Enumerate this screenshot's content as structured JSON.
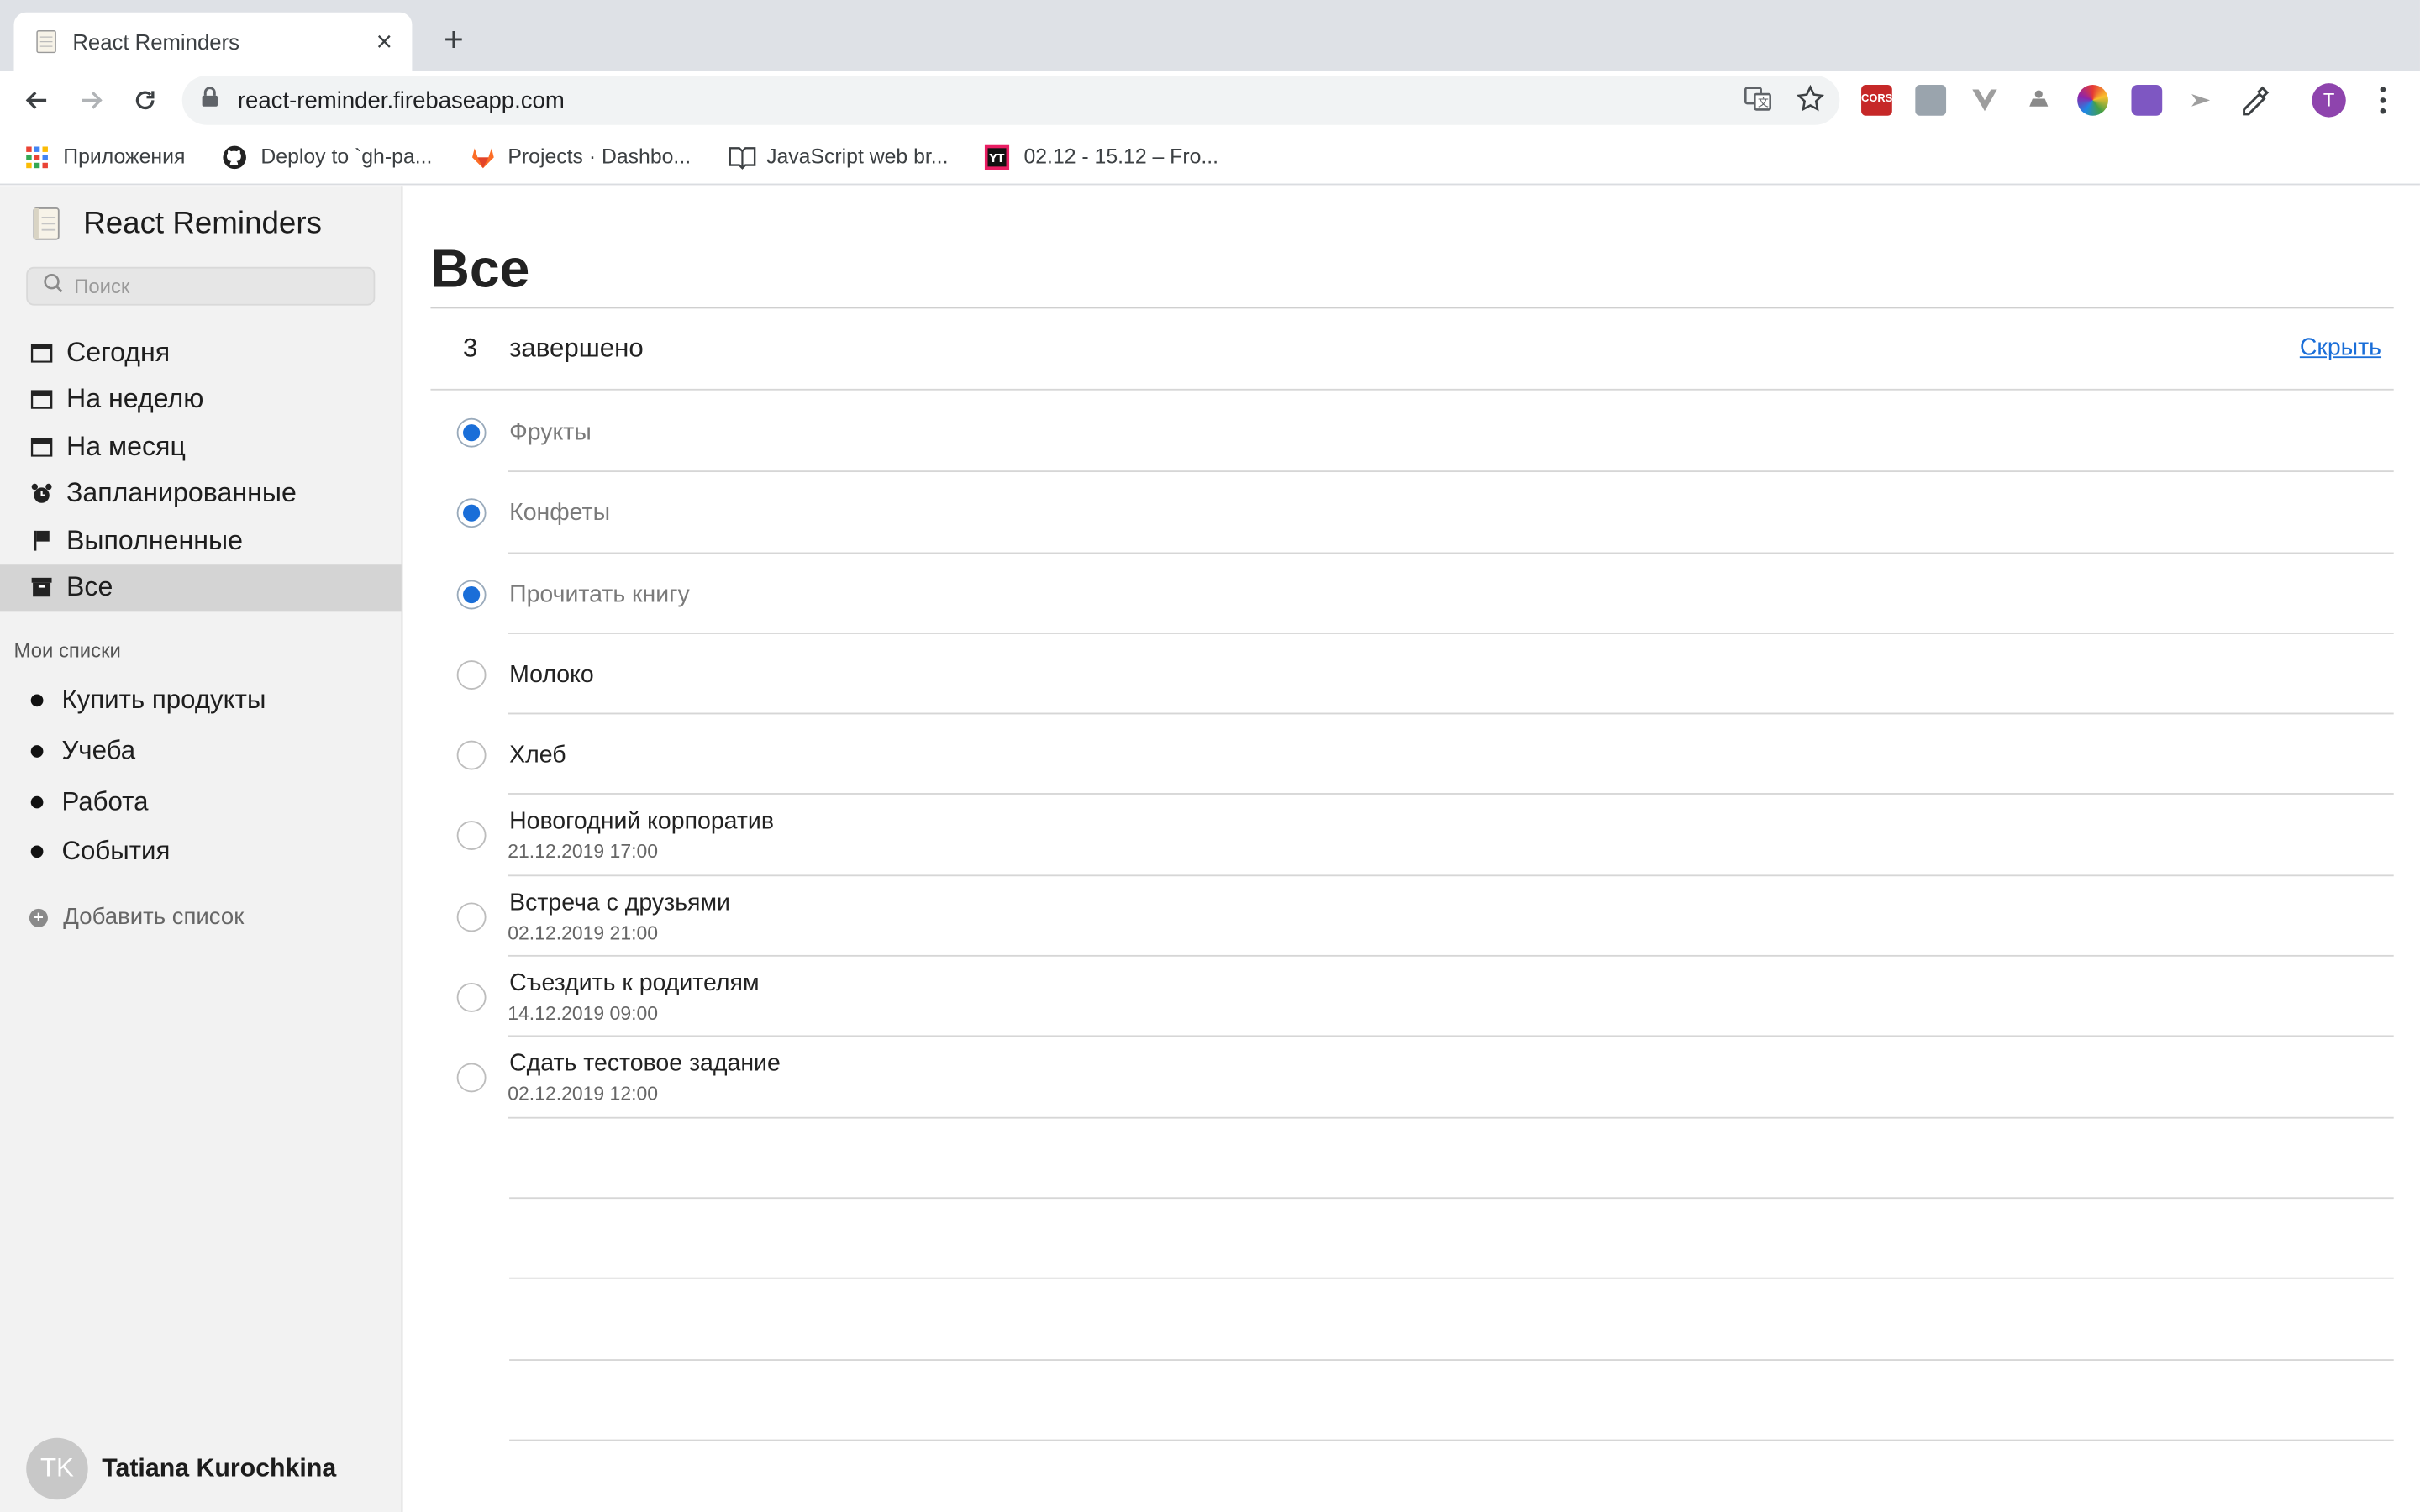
{
  "browser": {
    "tab_title": "React Reminders",
    "url": "react-reminder.firebaseapp.com",
    "bookmarks": [
      {
        "label": "Приложения",
        "icon": "apps-grid-icon"
      },
      {
        "label": "Deploy to `gh-pa...",
        "icon": "github-icon"
      },
      {
        "label": "Projects · Dashbo...",
        "icon": "gitlab-icon"
      },
      {
        "label": "JavaScript web br...",
        "icon": "book-icon"
      },
      {
        "label": "02.12 - 15.12 – Fro...",
        "icon": "youtrack-icon"
      }
    ],
    "profile_initial": "T",
    "extensions": [
      "cors-extension-icon",
      "profile-extension-icon",
      "vue-devtools-icon",
      "extension-icon",
      "color-picker-icon",
      "redux-devtools-icon",
      "extension-icon",
      "paint-extension-icon"
    ]
  },
  "sidebar": {
    "app_title": "React Reminders",
    "search_placeholder": "Поиск",
    "nav": [
      {
        "label": "Сегодня",
        "icon": "calendar-icon",
        "active": false
      },
      {
        "label": "На неделю",
        "icon": "calendar-icon",
        "active": false
      },
      {
        "label": "На месяц",
        "icon": "calendar-icon",
        "active": false
      },
      {
        "label": "Запланированные",
        "icon": "alarm-clock-icon",
        "active": false
      },
      {
        "label": "Выполненные",
        "icon": "flag-icon",
        "active": false
      },
      {
        "label": "Все",
        "icon": "archive-icon",
        "active": true
      }
    ],
    "lists_heading": "Мои списки",
    "lists": [
      "Купить продукты",
      "Учеба",
      "Работа",
      "События"
    ],
    "add_list_label": "Добавить список",
    "user": {
      "initials": "TK",
      "name": "Tatiana Kurochkina"
    }
  },
  "main": {
    "title": "Все",
    "completed_count": "3",
    "completed_label": "завершено",
    "hide_label": "Скрыть",
    "items": [
      {
        "title": "Фрукты",
        "done": true,
        "due": ""
      },
      {
        "title": "Конфеты",
        "done": true,
        "due": ""
      },
      {
        "title": "Прочитать книгу",
        "done": true,
        "due": ""
      },
      {
        "title": "Молоко",
        "done": false,
        "due": ""
      },
      {
        "title": "Хлеб",
        "done": false,
        "due": ""
      },
      {
        "title": "Новогодний корпоратив",
        "done": false,
        "due": "21.12.2019 17:00"
      },
      {
        "title": "Встреча с друзьями",
        "done": false,
        "due": "02.12.2019 21:00"
      },
      {
        "title": "Съездить к родителям",
        "done": false,
        "due": "14.12.2019 09:00"
      },
      {
        "title": "Сдать тестовое задание",
        "done": false,
        "due": "02.12.2019 12:00"
      }
    ],
    "blank_rows": 4
  },
  "colors": {
    "accent": "#1a6ed8",
    "sidebar_bg": "#f2f2f2",
    "active_nav": "#d4d4d4"
  }
}
